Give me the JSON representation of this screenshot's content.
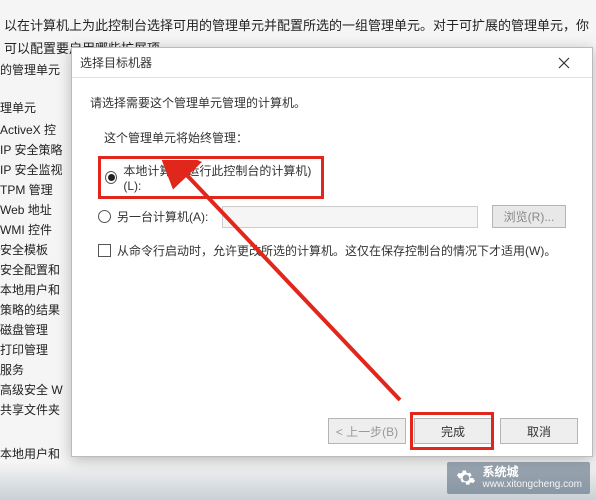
{
  "background": {
    "intro": "以在计算机上为此控制台选择可用的管理单元并配置所选的一组管理单元。对于可扩展的管理单元，你可以配置要启用哪些扩展项",
    "section1": "的管理单元",
    "section2": "理单元",
    "items": [
      "ActiveX 控",
      "IP 安全策略",
      "IP 安全监视",
      "TPM 管理",
      "Web 地址",
      "WMI 控件",
      "安全模板",
      "安全配置和",
      "本地用户和",
      "策略的结果",
      "磁盘管理",
      "打印管理",
      "服务",
      "高级安全 W",
      "共享文件夹"
    ],
    "footer": "本地用户和"
  },
  "dialog": {
    "title": "选择目标机器",
    "prompt": "请选择需要这个管理单元管理的计算机。",
    "subhead": "这个管理单元将始终管理：",
    "radio_local": "本地计算机(运行此控制台的计算机)(L):",
    "radio_other": "另一台计算机(A):",
    "browse": "浏览(R)...",
    "checkbox": "从命令行启动时，允许更改所选的计算机。这仅在保存控制台的情况下才适用(W)。",
    "back": "< 上一步(B)",
    "finish": "完成",
    "cancel": "取消"
  },
  "watermark": {
    "brand": "系统城",
    "url": "www.xitongcheng.com"
  }
}
